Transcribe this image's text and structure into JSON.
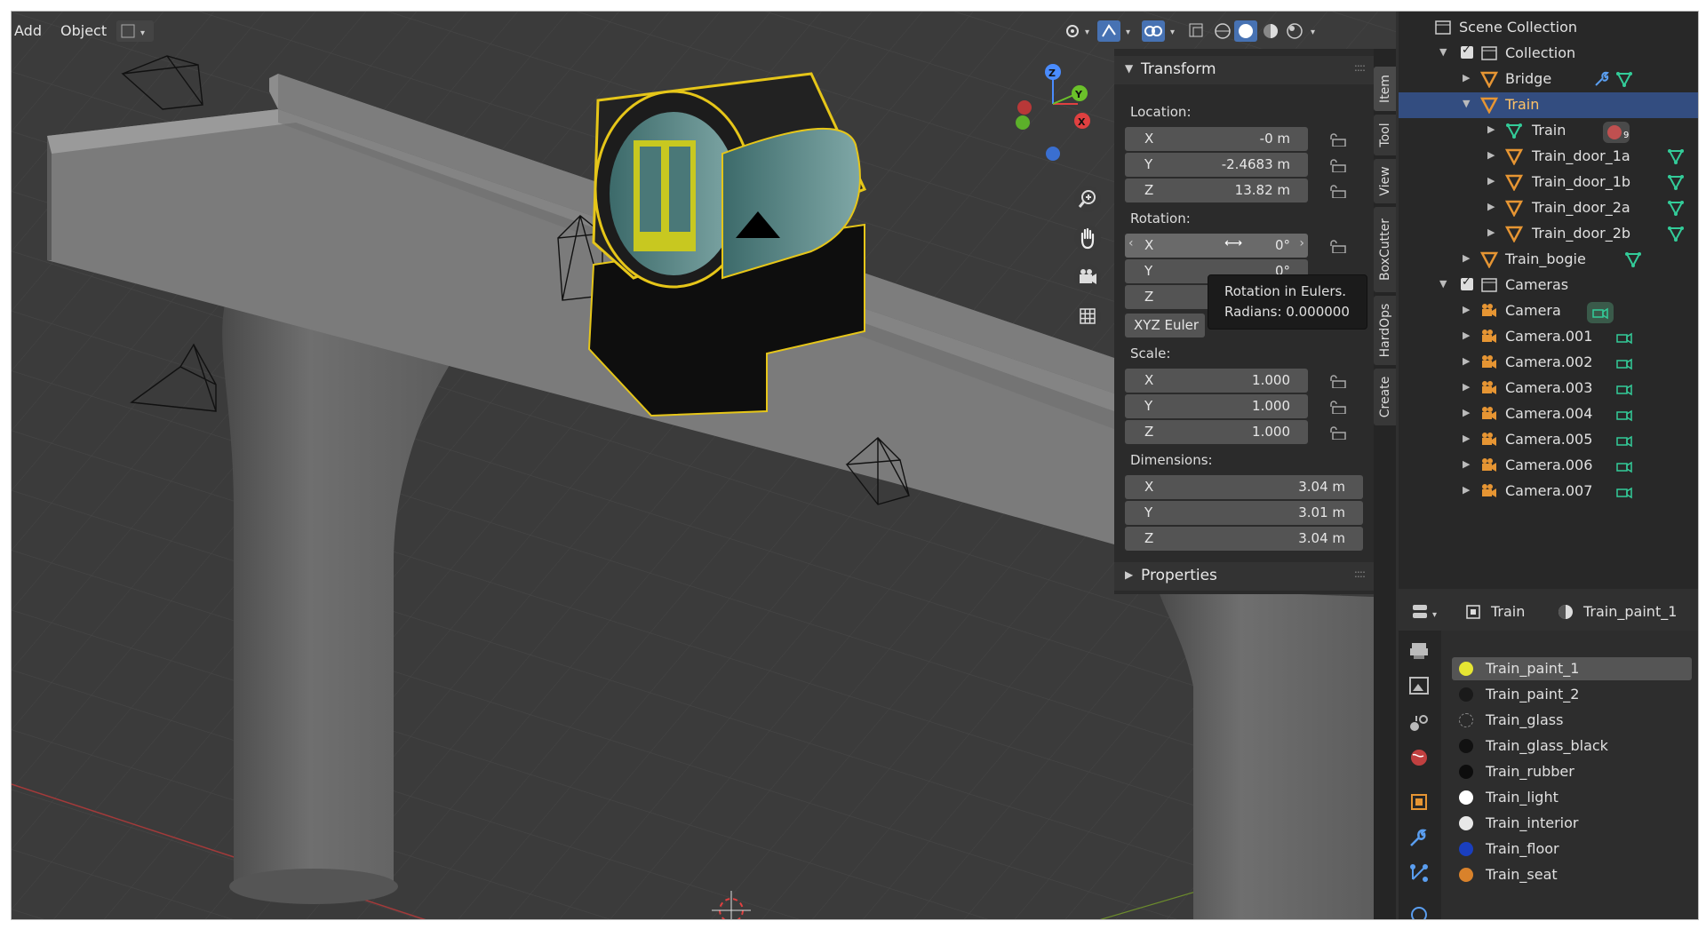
{
  "header": {
    "add_label": "Add",
    "object_label": "Object"
  },
  "transform": {
    "title": "Transform",
    "location_label": "Location:",
    "location": [
      {
        "axis": "X",
        "value": "-0 m"
      },
      {
        "axis": "Y",
        "value": "-2.4683 m"
      },
      {
        "axis": "Z",
        "value": "13.82 m"
      }
    ],
    "rotation_label": "Rotation:",
    "rotation": [
      {
        "axis": "X",
        "value": "0°"
      },
      {
        "axis": "Y",
        "value": "0°"
      },
      {
        "axis": "Z",
        "value": ""
      }
    ],
    "rotation_mode": "XYZ Euler",
    "scale_label": "Scale:",
    "scale": [
      {
        "axis": "X",
        "value": "1.000"
      },
      {
        "axis": "Y",
        "value": "1.000"
      },
      {
        "axis": "Z",
        "value": "1.000"
      }
    ],
    "dimensions_label": "Dimensions:",
    "dimensions": [
      {
        "axis": "X",
        "value": "3.04 m"
      },
      {
        "axis": "Y",
        "value": "3.01 m"
      },
      {
        "axis": "Z",
        "value": "3.04 m"
      }
    ]
  },
  "properties_panel": {
    "title": "Properties"
  },
  "tooltip": {
    "line1": "Rotation in Eulers.",
    "line2": "Radians: 0.000000"
  },
  "side_tabs": [
    "Item",
    "Tool",
    "View",
    "BoxCutter",
    "HardOps",
    "Create"
  ],
  "gizmo": {
    "z": "Z",
    "y": "Y",
    "x": "X"
  },
  "outliner": {
    "scene": "Scene Collection",
    "collection": "Collection",
    "bridge": "Bridge",
    "train": "Train",
    "train_mesh": "Train",
    "train_mesh_badge": "9",
    "doors": [
      "Train_door_1a",
      "Train_door_1b",
      "Train_door_2a",
      "Train_door_2b"
    ],
    "bogie": "Train_bogie",
    "cameras_collection": "Cameras",
    "cameras": [
      "Camera",
      "Camera.001",
      "Camera.002",
      "Camera.003",
      "Camera.004",
      "Camera.005",
      "Camera.006",
      "Camera.007"
    ]
  },
  "properties": {
    "object_name": "Train",
    "material_name": "Train_paint_1",
    "materials": [
      {
        "name": "Train_paint_1",
        "color": "#e6e633"
      },
      {
        "name": "Train_paint_2",
        "color": "#1a1a1a"
      },
      {
        "name": "Train_glass",
        "color": "#2a2a2a"
      },
      {
        "name": "Train_glass_black",
        "color": "#111111"
      },
      {
        "name": "Train_rubber",
        "color": "#0d0d0d"
      },
      {
        "name": "Train_light",
        "color": "#ffffff"
      },
      {
        "name": "Train_interior",
        "color": "#e8e8e8"
      },
      {
        "name": "Train_floor",
        "color": "#1a3fbf"
      },
      {
        "name": "Train_seat",
        "color": "#d9822b"
      }
    ]
  },
  "colors": {
    "selection": "#334d80",
    "accent": "#e6c619",
    "object_icon": "#e69533",
    "mesh_icon": "#33cc99"
  }
}
